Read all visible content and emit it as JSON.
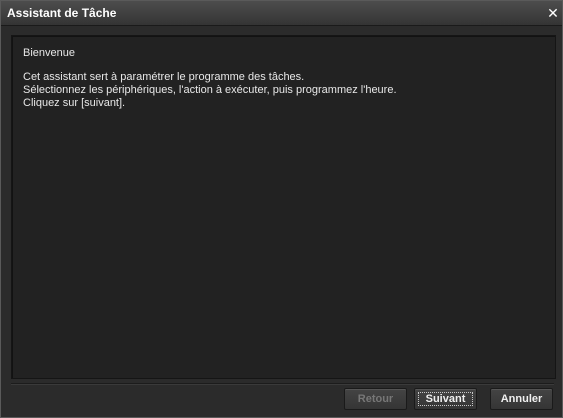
{
  "window": {
    "title": "Assistant de Tâche",
    "close_glyph": "✕"
  },
  "content": {
    "heading": "Bienvenue",
    "lines": [
      "Cet assistant sert à paramétrer le programme des tâches.",
      "Sélectionnez les périphériques, l'action à exécuter, puis programmez l'heure.",
      "Cliquez sur [suivant]."
    ]
  },
  "buttons": {
    "back_label": "Retour",
    "next_label": "Suivant",
    "cancel_label": "Annuler"
  },
  "colors": {
    "window_bg": "#2b2b2b",
    "panel_bg": "#222222",
    "text": "#e8e8e8"
  }
}
